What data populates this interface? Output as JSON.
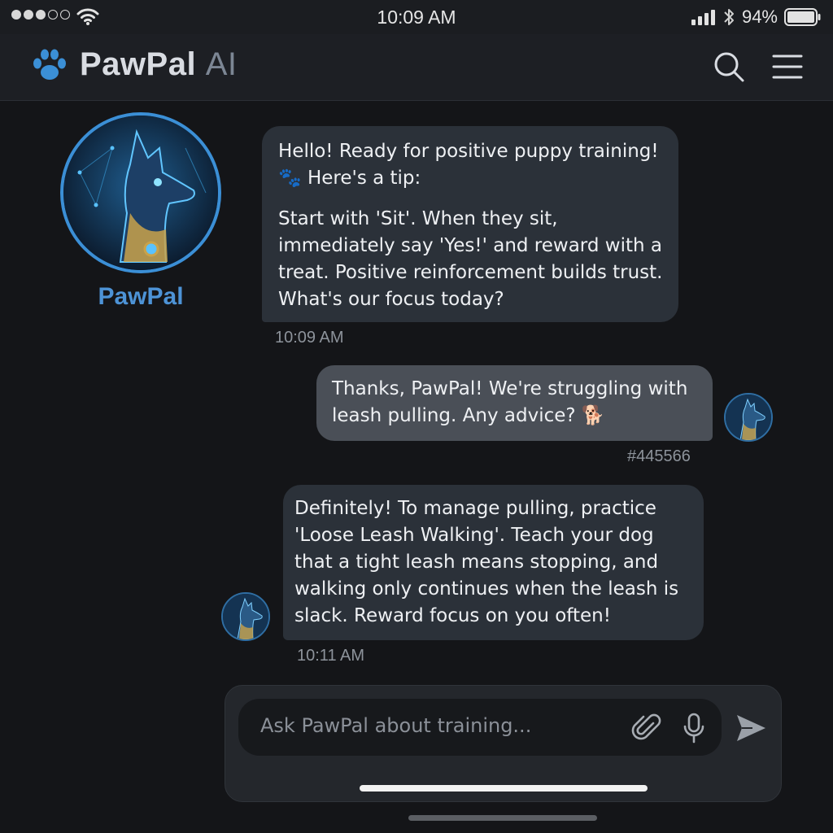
{
  "status_bar": {
    "time": "10:09 AM",
    "battery_percent": "94%",
    "signal_bars_filled": 3,
    "signal_dots_total": 5
  },
  "header": {
    "brand": "PawPal",
    "brand_suffix": "AI",
    "accent_color": "#3b8fd6",
    "icons": [
      "paw-icon",
      "search-icon",
      "menu-icon"
    ]
  },
  "bot_profile": {
    "name": "PawPal"
  },
  "messages": [
    {
      "sender": "bot",
      "paragraphs": [
        "Hello! Ready for positive puppy training! 🐾 Here's a tip:",
        "Start with 'Sit'. When they sit, immediately say 'Yes!' and reward with a treat. Positive reinforcement builds trust. What's our focus today?"
      ],
      "timestamp": "10:09 AM"
    },
    {
      "sender": "user",
      "paragraphs": [
        "Thanks, PawPal! We're struggling with leash pulling. Any advice? 🐕"
      ],
      "timestamp": "#445566"
    },
    {
      "sender": "bot",
      "paragraphs": [
        "Definitely! To manage pulling, practice 'Loose Leash Walking'. Teach your dog that a tight leash means stopping, and walking only continues when the leash is slack. Reward focus on you often!"
      ],
      "timestamp": "10:11 AM"
    }
  ],
  "composer": {
    "placeholder": "Ask PawPal about training..."
  }
}
